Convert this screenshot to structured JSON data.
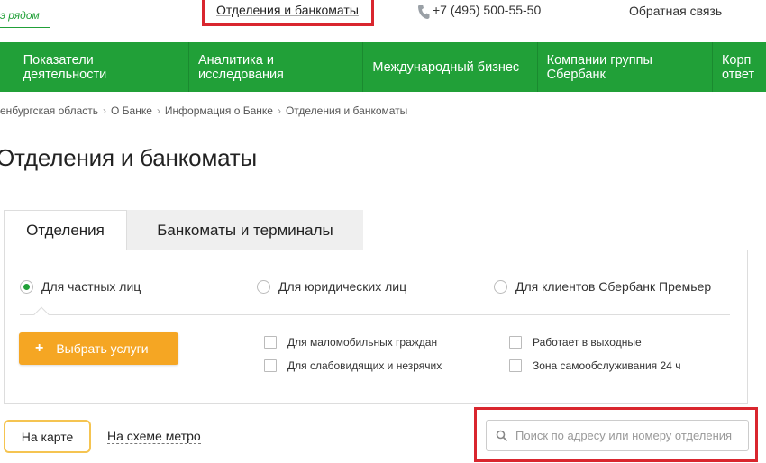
{
  "header": {
    "tagline": "э рядом",
    "branches_link": "Отделения и банкоматы",
    "phone": "+7 (495) 500-55-50",
    "feedback": "Обратная связь"
  },
  "nav": {
    "items": [
      {
        "label": "Показатели\nдеятельности"
      },
      {
        "label": "Аналитика и\nисследования"
      },
      {
        "label": "Международный бизнес"
      },
      {
        "label": "Компании группы\nСбербанк"
      },
      {
        "label": "Корп\nответ"
      }
    ]
  },
  "breadcrumbs": [
    "енбургская область",
    "О Банке",
    "Информация о Банке",
    "Отделения и банкоматы"
  ],
  "page_title": "Отделения и банкоматы",
  "tabs": [
    {
      "label": "Отделения",
      "active": true
    },
    {
      "label": "Банкоматы и терминалы",
      "active": false
    }
  ],
  "client_types": [
    {
      "label": "Для частных лиц",
      "selected": true
    },
    {
      "label": "Для юридических лиц",
      "selected": false
    },
    {
      "label": "Для клиентов Сбербанк Премьер",
      "selected": false
    }
  ],
  "choose_services": {
    "plus": "+",
    "label": "Выбрать услуги"
  },
  "filters": [
    {
      "label": "Для маломобильных граждан",
      "checked": false
    },
    {
      "label": "Для слабовидящих и незрячих",
      "checked": false
    },
    {
      "label": "Работает в выходные",
      "checked": false
    },
    {
      "label": "Зона самообслуживания 24 ч",
      "checked": false
    }
  ],
  "view_modes": {
    "map": "На карте",
    "metro": "На схеме метро"
  },
  "search": {
    "placeholder": "Поиск по адресу или номеру отделения",
    "value": ""
  },
  "colors": {
    "brand_green": "#21a038",
    "accent_orange": "#f5a623",
    "highlight_red": "#d9262e"
  }
}
